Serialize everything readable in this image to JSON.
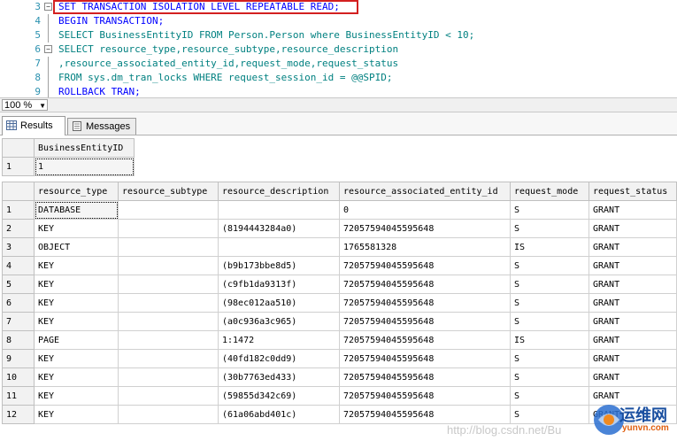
{
  "editor": {
    "lines": [
      {
        "num": "3",
        "text": "SET TRANSACTION ISOLATION LEVEL REPEATABLE READ;"
      },
      {
        "num": "4",
        "text": "BEGIN TRANSACTION;"
      },
      {
        "num": "5",
        "text": "SELECT BusinessEntityID FROM Person.Person where BusinessEntityID < 10;"
      },
      {
        "num": "6",
        "text": "SELECT resource_type,resource_subtype,resource_description"
      },
      {
        "num": "7",
        "text": ",resource_associated_entity_id,request_mode,request_status"
      },
      {
        "num": "8",
        "text": "FROM sys.dm_tran_locks WHERE request_session_id = @@SPID;"
      },
      {
        "num": "9",
        "text": "ROLLBACK TRAN;"
      }
    ]
  },
  "zoom": {
    "value": "100 %"
  },
  "tabs": [
    {
      "label": "Results"
    },
    {
      "label": "Messages"
    }
  ],
  "grid1": {
    "columns": [
      "BusinessEntityID"
    ],
    "rows": [
      {
        "num": "1",
        "cells": [
          "1"
        ]
      }
    ]
  },
  "grid2": {
    "columns": [
      "resource_type",
      "resource_subtype",
      "resource_description",
      "resource_associated_entity_id",
      "request_mode",
      "request_status"
    ],
    "rows": [
      {
        "num": "1",
        "cells": [
          "DATABASE",
          "",
          "",
          "0",
          "S",
          "GRANT"
        ]
      },
      {
        "num": "2",
        "cells": [
          "KEY",
          "",
          "(8194443284a0)",
          "72057594045595648",
          "S",
          "GRANT"
        ]
      },
      {
        "num": "3",
        "cells": [
          "OBJECT",
          "",
          "",
          "1765581328",
          "IS",
          "GRANT"
        ]
      },
      {
        "num": "4",
        "cells": [
          "KEY",
          "",
          "(b9b173bbe8d5)",
          "72057594045595648",
          "S",
          "GRANT"
        ]
      },
      {
        "num": "5",
        "cells": [
          "KEY",
          "",
          "(c9fb1da9313f)",
          "72057594045595648",
          "S",
          "GRANT"
        ]
      },
      {
        "num": "6",
        "cells": [
          "KEY",
          "",
          "(98ec012aa510)",
          "72057594045595648",
          "S",
          "GRANT"
        ]
      },
      {
        "num": "7",
        "cells": [
          "KEY",
          "",
          "(a0c936a3c965)",
          "72057594045595648",
          "S",
          "GRANT"
        ]
      },
      {
        "num": "8",
        "cells": [
          "PAGE",
          "",
          "1:1472",
          "72057594045595648",
          "IS",
          "GRANT"
        ]
      },
      {
        "num": "9",
        "cells": [
          "KEY",
          "",
          "(40fd182c0dd9)",
          "72057594045595648",
          "S",
          "GRANT"
        ]
      },
      {
        "num": "10",
        "cells": [
          "KEY",
          "",
          "(30b7763ed433)",
          "72057594045595648",
          "S",
          "GRANT"
        ]
      },
      {
        "num": "11",
        "cells": [
          "KEY",
          "",
          "(59855d342c69)",
          "72057594045595648",
          "S",
          "GRANT"
        ]
      },
      {
        "num": "12",
        "cells": [
          "KEY",
          "",
          "(61a06abd401c)",
          "72057594045595648",
          "S",
          "GRANT"
        ]
      }
    ]
  },
  "watermark": {
    "text": "http://blog.csdn.net/Bu",
    "logo_text": "运维网",
    "logo_url": "yunvn.com"
  }
}
